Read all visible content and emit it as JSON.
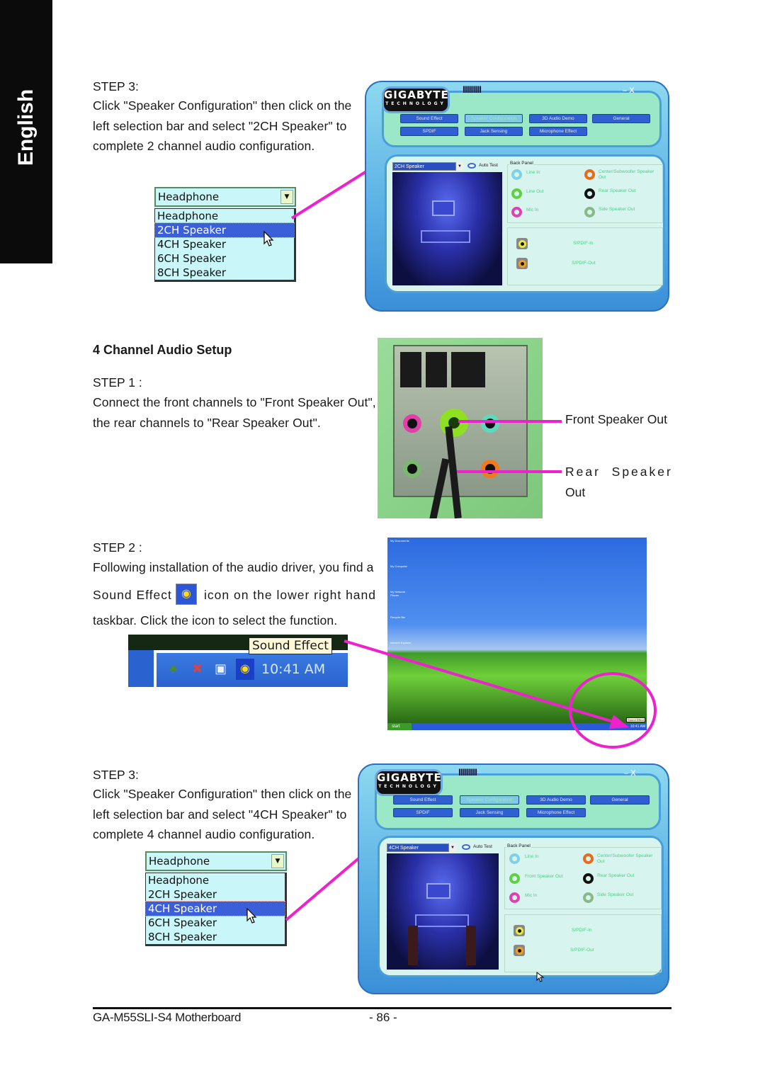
{
  "side_tab": {
    "label": "English"
  },
  "section1": {
    "step_label": "STEP 3:",
    "lines": [
      "Click \"Speaker Configuration\" then click on the",
      "left selection bar and select \"2CH Speaker\" to",
      "complete 2 channel audio configuration."
    ],
    "dropdown": {
      "current": "Headphone",
      "options": [
        "Headphone",
        "2CH Speaker",
        "4CH Speaker",
        "6CH Speaker",
        "8CH Speaker"
      ],
      "highlighted": "2CH Speaker"
    }
  },
  "app_window_1": {
    "brand": "GIGABYTE",
    "brand_sub": "TECHNOLOGY",
    "ticks": "IIIIIIIII",
    "window_controls": {
      "minimize": "–",
      "close": "X"
    },
    "tabs_row1": [
      "Sound Effect",
      "Speaker Configuration",
      "3D Audio Demo",
      "General"
    ],
    "tabs_row2": [
      "SPDIF",
      "Jack Sensing",
      "Microphone Effect"
    ],
    "active_tab": "Speaker Configuration",
    "speaker_select": "2CH Speaker",
    "auto_test": "Auto Test",
    "back_panel_title": "Back Panel",
    "jacks": [
      {
        "label": "Line In",
        "color": "#7fd0e8"
      },
      {
        "label": "Center/Subwoofer Speaker Out",
        "color": "#e86a1a"
      },
      {
        "label": "Line Out",
        "color": "#5fd040"
      },
      {
        "label": "Rear Speaker Out",
        "color": "#111111"
      },
      {
        "label": "Mic In",
        "color": "#e040b0"
      },
      {
        "label": "Side Speaker Out",
        "color": "#8ab888"
      }
    ],
    "spdif": [
      {
        "label": "S/PDIF-In",
        "color": "#e8e840"
      },
      {
        "label": "S/PDIF-Out",
        "color": "#f0a020"
      }
    ]
  },
  "section2": {
    "title": "4 Channel Audio Setup",
    "step1_label": "STEP 1 :",
    "step1_lines": [
      "Connect the front channels to \"Front Speaker Out\",",
      "the rear channels to \"Rear Speaker Out\"."
    ],
    "callouts": {
      "front": "Front Speaker Out",
      "rear_line1": "Rear  Speaker",
      "rear_line2": "Out"
    },
    "step2_label": "STEP 2 :",
    "step2_line1": "Following installation of the audio driver, you find a",
    "step2_line2a": "Sound Effect",
    "step2_line2b": "icon on the lower right hand",
    "step2_line3": "taskbar.  Click the icon to select the function.",
    "tray": {
      "tooltip": "Sound Effect",
      "clock": "10:41 AM"
    },
    "desktop": {
      "icons": [
        "My Documents",
        "My Computer",
        "My Network Places",
        "Recycle Bin",
        "Internet Explorer"
      ],
      "start": "start",
      "tooltip": "Sound Effect",
      "clock": "10:41 AM"
    }
  },
  "section3": {
    "step_label": "STEP 3:",
    "lines": [
      "Click \"Speaker Configuration\" then click on the",
      "left selection bar and select \"4CH Speaker\" to",
      "complete 4 channel audio configuration."
    ],
    "dropdown": {
      "current": "Headphone",
      "options": [
        "Headphone",
        "2CH Speaker",
        "4CH Speaker",
        "6CH Speaker",
        "8CH Speaker"
      ],
      "highlighted": "4CH Speaker"
    }
  },
  "app_window_2": {
    "brand": "GIGABYTE",
    "brand_sub": "TECHNOLOGY",
    "ticks": "IIIIIIIII",
    "window_controls": {
      "minimize": "–",
      "close": "X"
    },
    "tabs_row1": [
      "Sound Effect",
      "Speaker Configuration",
      "3D Audio Demo",
      "General"
    ],
    "tabs_row2": [
      "SPDIF",
      "Jack Sensing",
      "Microphone Effect"
    ],
    "active_tab": "Speaker Configuration",
    "speaker_select": "4CH Speaker",
    "auto_test": "Auto Test",
    "back_panel_title": "Back Panel",
    "jacks": [
      {
        "label": "Line In",
        "color": "#7fd0e8"
      },
      {
        "label": "Center/Subwoofer Speaker Out",
        "color": "#e86a1a"
      },
      {
        "label": "Front Speaker Out",
        "color": "#5fd040"
      },
      {
        "label": "Rear Speaker Out",
        "color": "#111111"
      },
      {
        "label": "Mic In",
        "color": "#e040b0"
      },
      {
        "label": "Side Speaker Out",
        "color": "#8ab888"
      }
    ],
    "spdif": [
      {
        "label": "S/PDIF-In",
        "color": "#e8e840"
      },
      {
        "label": "S/PDIF-Out",
        "color": "#f0a020"
      }
    ]
  },
  "footer": {
    "model": "GA-M55SLI-S4 Motherboard",
    "page": "- 86 -"
  },
  "colors": {
    "callout": "#ee22cc",
    "highlight": "#3b5fd9",
    "window_blue": "#3a8fd8"
  }
}
